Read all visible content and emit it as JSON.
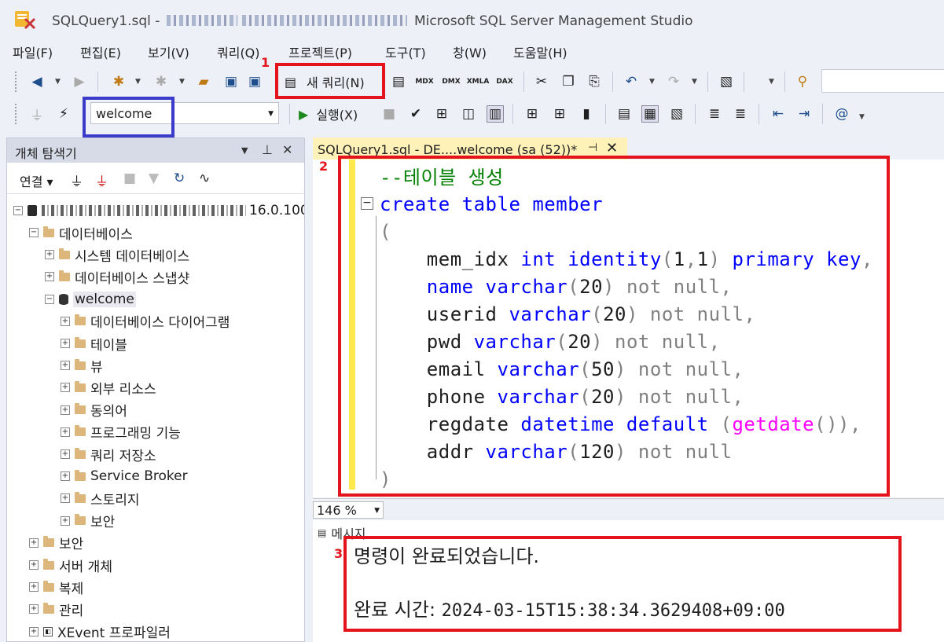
{
  "window": {
    "title_file": "SQLQuery1.sql -",
    "title_app": "Microsoft SQL Server Management Studio"
  },
  "menu": [
    "파일(F)",
    "편집(E)",
    "보기(V)",
    "쿼리(Q)",
    "프로젝트(P)",
    "도구(T)",
    "창(W)",
    "도움말(H)"
  ],
  "toolbar": {
    "new_query_label": "새 쿼리(N)",
    "db_icons": [
      "MDX",
      "DMX",
      "XMLA",
      "DAX"
    ],
    "database_select": "welcome",
    "execute_label": "실행(X)"
  },
  "annotations": {
    "n1": "1",
    "n2": "2",
    "n3": "3"
  },
  "object_explorer": {
    "title": "개체 탐색기",
    "connect_label": "연결",
    "server_version": "16.0.100",
    "tree": [
      {
        "label": "데이터베이스",
        "level": 1,
        "type": "folder",
        "expanded": true
      },
      {
        "label": "시스템 데이터베이스",
        "level": 2,
        "type": "folder"
      },
      {
        "label": "데이터베이스 스냅샷",
        "level": 2,
        "type": "folder"
      },
      {
        "label": "welcome",
        "level": 2,
        "type": "db",
        "expanded": true
      },
      {
        "label": "데이터베이스 다이어그램",
        "level": 3,
        "type": "folder"
      },
      {
        "label": "테이블",
        "level": 3,
        "type": "folder"
      },
      {
        "label": "뷰",
        "level": 3,
        "type": "folder"
      },
      {
        "label": "외부 리소스",
        "level": 3,
        "type": "folder"
      },
      {
        "label": "동의어",
        "level": 3,
        "type": "folder"
      },
      {
        "label": "프로그래밍 기능",
        "level": 3,
        "type": "folder"
      },
      {
        "label": "쿼리 저장소",
        "level": 3,
        "type": "folder"
      },
      {
        "label": "Service Broker",
        "level": 3,
        "type": "folder"
      },
      {
        "label": "스토리지",
        "level": 3,
        "type": "folder"
      },
      {
        "label": "보안",
        "level": 3,
        "type": "folder"
      },
      {
        "label": "보안",
        "level": 1,
        "type": "folder"
      },
      {
        "label": "서버 개체",
        "level": 1,
        "type": "folder"
      },
      {
        "label": "복제",
        "level": 1,
        "type": "folder"
      },
      {
        "label": "관리",
        "level": 1,
        "type": "folder"
      },
      {
        "label": "XEvent 프로파일러",
        "level": 1,
        "type": "xevent"
      }
    ]
  },
  "editor": {
    "tab_label": "SQLQuery1.sql - DE....welcome (sa (52))*",
    "zoom": "146 %",
    "code": {
      "comment": "--테이블 생성",
      "l1_kw": "create table member",
      "open_paren": "(",
      "close_paren": ")"
    }
  },
  "results": {
    "tab_label": "메시지",
    "line1": "명령이 완료되었습니다.",
    "line2_label": "완료 시간: ",
    "line2_value": "2024-03-15T15:38:34.3629408+09:00"
  }
}
